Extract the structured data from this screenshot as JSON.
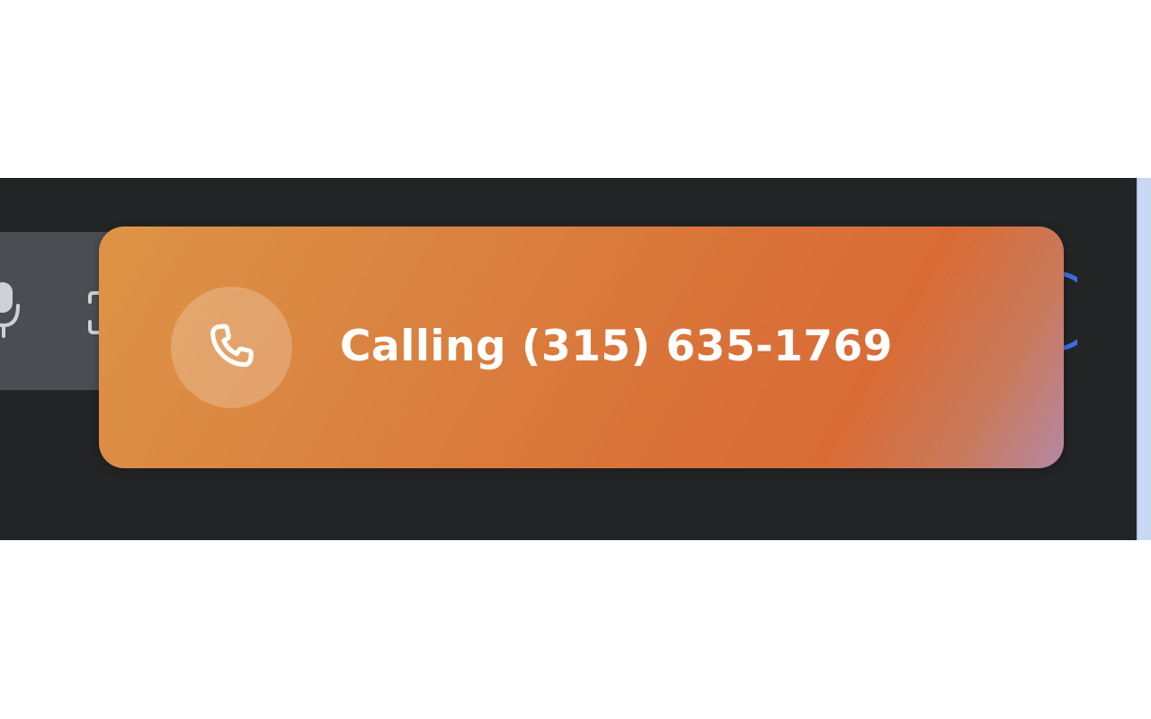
{
  "call_banner": {
    "label": "Calling",
    "phone_number": "(315) 635-1769",
    "icon": "phone-icon"
  },
  "colors": {
    "background_dark": "#232426",
    "banner_start": "#dd9446",
    "banner_mid": "#d96c36",
    "banner_end": "#b587a3",
    "toolbar_panel": "#4a4d52",
    "accent_blue": "#3b6fe0",
    "side_strip": "#c9d9f4"
  },
  "toolbar": {
    "icons": [
      "microphone-icon",
      "screen-share-icon"
    ]
  }
}
